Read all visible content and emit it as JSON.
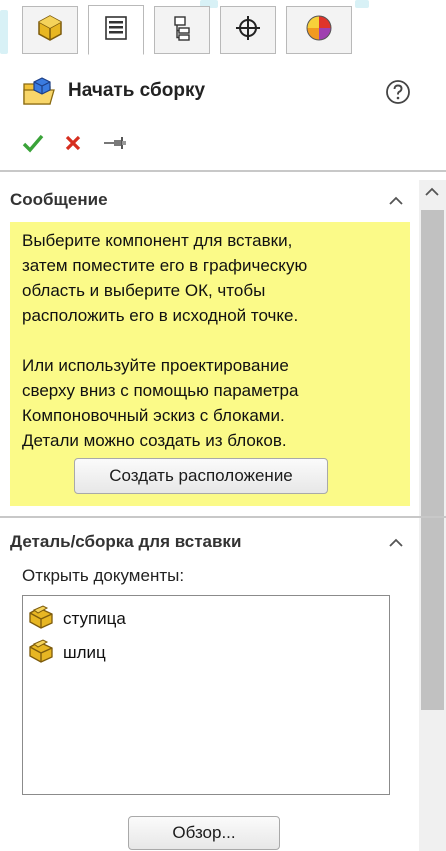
{
  "header": {
    "title": "Начать сборку"
  },
  "tabs": [
    {
      "icon": "feature-manager-icon"
    },
    {
      "icon": "property-manager-icon"
    },
    {
      "icon": "configuration-manager-icon"
    },
    {
      "icon": "dimxpert-icon"
    },
    {
      "icon": "display-manager-icon"
    }
  ],
  "message_section": {
    "title": "Сообщение",
    "lines": [
      "Выберите компонент для вставки,",
      "затем поместите его в графическую",
      "область и выберите ОК, чтобы",
      "расположить его в исходной точке.",
      "Или используйте проектирование",
      "сверху вниз с помощью параметра",
      "Компоновочный эскиз с блоками.",
      "Детали можно создать из блоков."
    ],
    "button": "Создать расположение"
  },
  "insert_section": {
    "title": "Деталь/сборка для вставки",
    "open_docs_label": "Открыть документы:",
    "documents": [
      "ступица",
      "шлиц"
    ],
    "browse_button": "Обзор..."
  },
  "colors": {
    "message_bg": "#fbfa88",
    "ok": "#3aa339",
    "cancel": "#d62e1f",
    "active_tab_bg": "#ffffff"
  }
}
